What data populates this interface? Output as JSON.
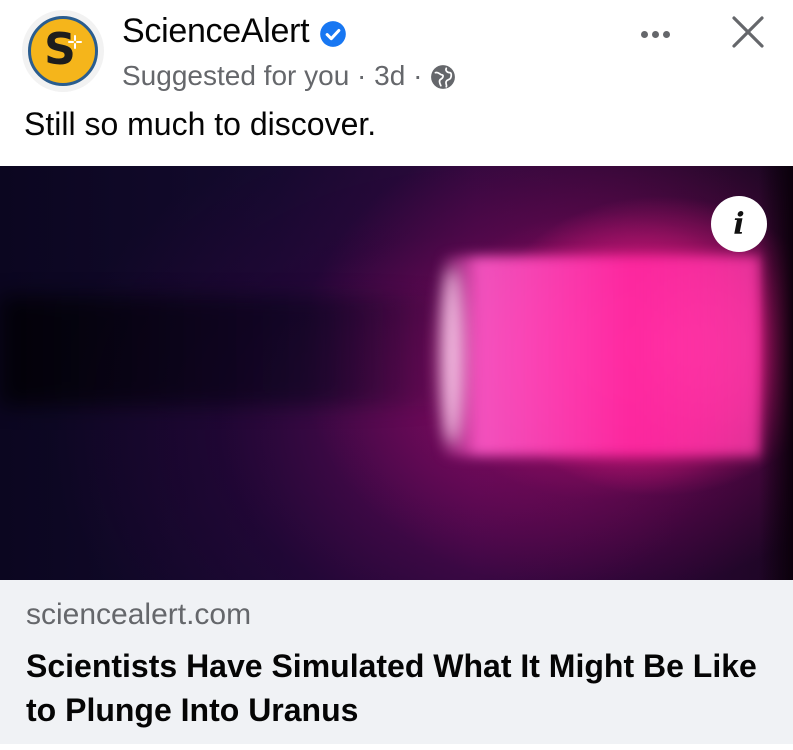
{
  "post": {
    "page_name": "ScienceAlert",
    "avatar_letter": "S",
    "verified_icon": "verified-badge-icon",
    "meta_text": "Suggested for you · 3d ·",
    "privacy_icon": "globe-icon",
    "caption": "Still so much to discover.",
    "accent_color": "#1877f2"
  },
  "media": {
    "info_label": "i"
  },
  "link_preview": {
    "domain": "sciencealert.com",
    "headline": "Scientists Have Simulated What It Might Be Like to Plunge Into Uranus"
  }
}
